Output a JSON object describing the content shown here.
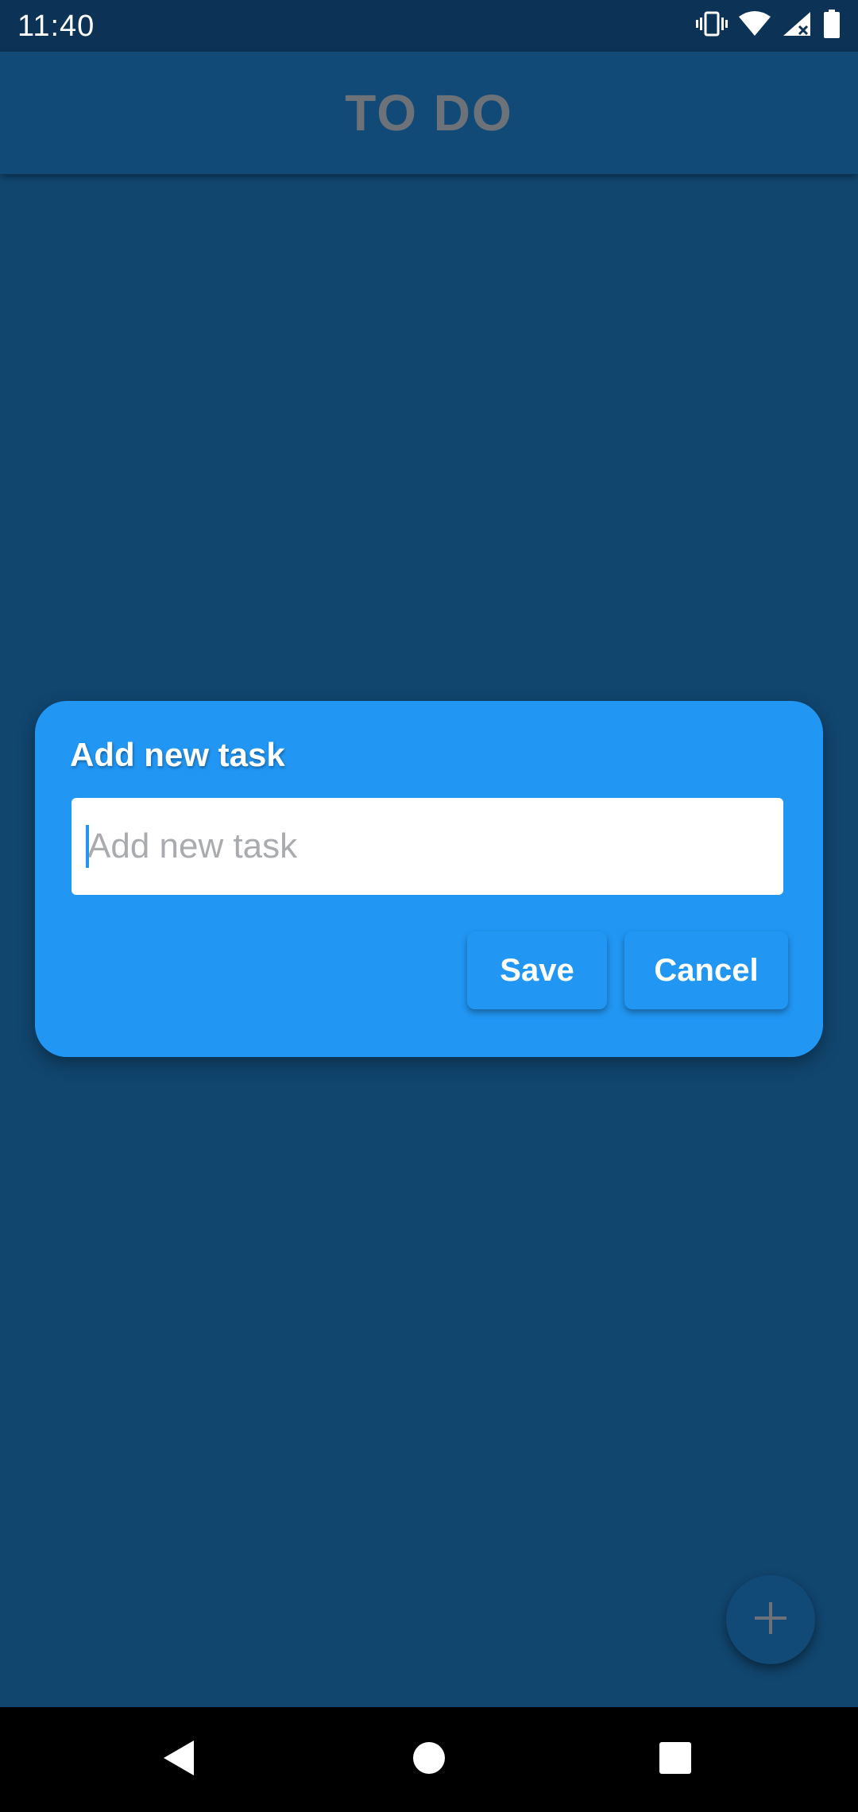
{
  "status_bar": {
    "time": "11:40",
    "icons": [
      "vibrate-icon",
      "wifi-icon",
      "signal-icon",
      "battery-icon"
    ]
  },
  "app_bar": {
    "title": "TO DO"
  },
  "dialog": {
    "title": "Add new task",
    "input": {
      "value": "",
      "placeholder": "Add new task"
    },
    "save_label": "Save",
    "cancel_label": "Cancel"
  },
  "fab": {
    "icon": "plus-icon"
  },
  "nav_bar": {
    "icons": [
      "back-icon",
      "home-icon",
      "recents-icon"
    ]
  },
  "colors": {
    "background": "#11466f",
    "status_bar": "#0c3355",
    "app_bar": "#124a77",
    "dialog": "#2196f3",
    "title_text": "#6d7279",
    "placeholder": "#a9abae"
  }
}
